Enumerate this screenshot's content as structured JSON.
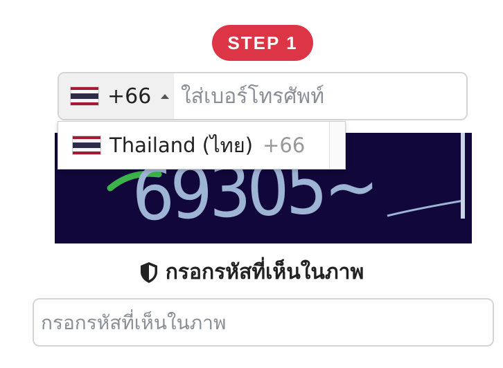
{
  "step_badge": {
    "label": "STEP 1",
    "color": "#dc3545"
  },
  "phone": {
    "country_flag": "thailand-flag",
    "dial_code": "+66",
    "placeholder": "ใส่เบอร์โทรศัพท์",
    "value": ""
  },
  "country_dropdown": {
    "options": [
      {
        "flag": "thailand-flag",
        "name": "Thailand (ไทย)",
        "dial_code": "+66"
      }
    ]
  },
  "captcha": {
    "image_text": "69305~"
  },
  "captcha_label": {
    "icon": "shield-icon",
    "text": "กรอกรหัสที่เห็นในภาพ"
  },
  "captcha_input": {
    "placeholder": "กรอกรหัสที่เห็นในภาพ",
    "value": ""
  }
}
